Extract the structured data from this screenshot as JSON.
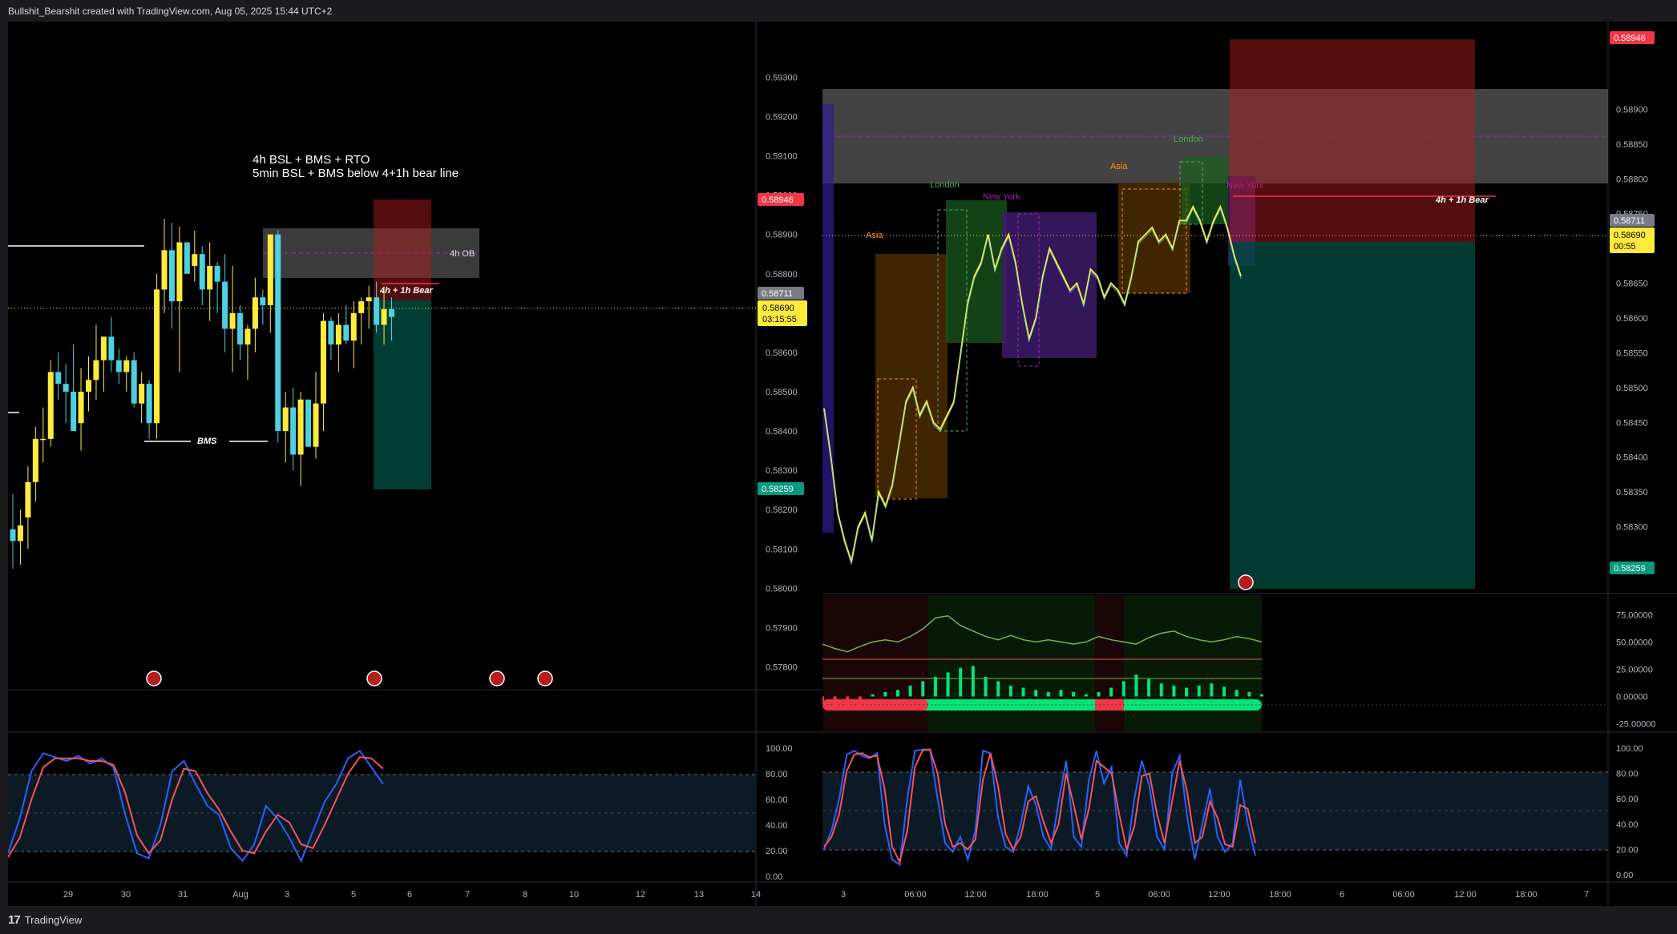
{
  "header": {
    "credit": "Bullshit_Bearshit created with TradingView.com, Aug 05, 2025 15:44 UTC+2"
  },
  "footer": {
    "brand_mark": "17",
    "brand": "TradingView"
  },
  "colors": {
    "background": "#000000",
    "bull": "#ffeb3b",
    "bear": "#4dd0e1",
    "price_tag": "#f23645",
    "target_tag": "#089981",
    "current_tag": "#ffeb3b"
  },
  "chart_data": [
    {
      "type": "candlestick",
      "panel": "left-main",
      "timeframe_hint": "1h",
      "x_ticks": [
        "29",
        "30",
        "31",
        "Aug",
        "3",
        "5",
        "6",
        "7",
        "8",
        "10",
        "12",
        "13",
        "14"
      ],
      "y_ticks": [
        "0.59300",
        "0.59200",
        "0.59100",
        "0.59000",
        "0.58900",
        "0.58800",
        "0.58600",
        "0.58500",
        "0.58400",
        "0.58300",
        "0.58200",
        "0.58100",
        "0.58000",
        "0.57900",
        "0.57800"
      ],
      "ylim": [
        0.5775,
        0.5936
      ],
      "annotations": {
        "note_line1": "4h BSL + BMS + RTO",
        "note_line2": "5min BSL + BMS below 4+1h bear line",
        "ob_label": "4h OB",
        "bear_label": "4h + 1h Bear",
        "bms_label": "BMS"
      },
      "tags": {
        "entry": "0.58946",
        "last_close": "0.58711",
        "current_price": "0.58690",
        "countdown": "03:15:55",
        "target": "0.58259"
      },
      "position": {
        "stop": 0.58946,
        "entry": 0.58711,
        "target": 0.58259
      },
      "ohlc": [
        [
          0.5815,
          0.5824,
          0.5805,
          0.5812
        ],
        [
          0.5812,
          0.582,
          0.5806,
          0.5816
        ],
        [
          0.5818,
          0.5831,
          0.581,
          0.5827
        ],
        [
          0.5827,
          0.5841,
          0.5822,
          0.5838
        ],
        [
          0.5838,
          0.5846,
          0.5832,
          0.5838
        ],
        [
          0.5838,
          0.5858,
          0.5836,
          0.5855
        ],
        [
          0.5855,
          0.586,
          0.5848,
          0.5852
        ],
        [
          0.5852,
          0.5857,
          0.5842,
          0.585
        ],
        [
          0.585,
          0.5862,
          0.584,
          0.584
        ],
        [
          0.5842,
          0.5856,
          0.5835,
          0.585
        ],
        [
          0.585,
          0.5859,
          0.5845,
          0.5853
        ],
        [
          0.5853,
          0.5867,
          0.5848,
          0.5858
        ],
        [
          0.5858,
          0.5864,
          0.585,
          0.5864
        ],
        [
          0.5864,
          0.5869,
          0.5855,
          0.5858
        ],
        [
          0.5858,
          0.5861,
          0.5852,
          0.5855
        ],
        [
          0.5855,
          0.5859,
          0.585,
          0.5858
        ],
        [
          0.5858,
          0.586,
          0.5846,
          0.5847
        ],
        [
          0.5847,
          0.5855,
          0.5842,
          0.5852
        ],
        [
          0.5852,
          0.5853,
          0.5838,
          0.5842
        ],
        [
          0.5842,
          0.588,
          0.5838,
          0.5876
        ],
        [
          0.5876,
          0.5894,
          0.587,
          0.5886
        ],
        [
          0.5886,
          0.5893,
          0.5866,
          0.5873
        ],
        [
          0.5873,
          0.5892,
          0.5855,
          0.5888
        ],
        [
          0.5888,
          0.5887,
          0.588,
          0.588
        ],
        [
          0.5882,
          0.5891,
          0.5878,
          0.5885
        ],
        [
          0.5885,
          0.5887,
          0.5872,
          0.5876
        ],
        [
          0.5876,
          0.5888,
          0.5868,
          0.5882
        ],
        [
          0.5882,
          0.5883,
          0.587,
          0.5878
        ],
        [
          0.5878,
          0.5885,
          0.586,
          0.5866
        ],
        [
          0.5866,
          0.5882,
          0.5855,
          0.587
        ],
        [
          0.587,
          0.5872,
          0.5858,
          0.5862
        ],
        [
          0.5862,
          0.5867,
          0.5853,
          0.5866
        ],
        [
          0.5866,
          0.5879,
          0.586,
          0.5874
        ],
        [
          0.5874,
          0.5876,
          0.5867,
          0.5872
        ],
        [
          0.5872,
          0.589,
          0.5865,
          0.589
        ],
        [
          0.589,
          0.5891,
          0.5837,
          0.584
        ],
        [
          0.584,
          0.585,
          0.5832,
          0.5846
        ],
        [
          0.5846,
          0.5851,
          0.583,
          0.5834
        ],
        [
          0.5834,
          0.585,
          0.5826,
          0.5848
        ],
        [
          0.5848,
          0.5845,
          0.5836,
          0.5836
        ],
        [
          0.5836,
          0.5855,
          0.5833,
          0.5847
        ],
        [
          0.5847,
          0.587,
          0.584,
          0.5868
        ],
        [
          0.5868,
          0.5869,
          0.5858,
          0.5862
        ],
        [
          0.5862,
          0.587,
          0.5855,
          0.5867
        ],
        [
          0.5867,
          0.5872,
          0.5862,
          0.5863
        ],
        [
          0.5863,
          0.5873,
          0.5856,
          0.587
        ],
        [
          0.587,
          0.5874,
          0.5862,
          0.5873
        ],
        [
          0.5873,
          0.5877,
          0.5866,
          0.5874
        ],
        [
          0.5874,
          0.5878,
          0.5865,
          0.5867
        ],
        [
          0.5867,
          0.5876,
          0.5862,
          0.5871
        ],
        [
          0.5871,
          0.5874,
          0.5863,
          0.5869
        ]
      ]
    },
    {
      "type": "line",
      "panel": "left-stochastic",
      "y_ticks": [
        "100.00",
        "80.00",
        "60.00",
        "40.00",
        "20.00",
        "0.00"
      ],
      "ylim": [
        0,
        100
      ],
      "levels": [
        80,
        50,
        20
      ],
      "k": [
        18,
        45,
        82,
        96,
        93,
        90,
        94,
        88,
        92,
        85,
        48,
        18,
        14,
        40,
        82,
        90,
        72,
        55,
        48,
        22,
        12,
        25,
        55,
        45,
        30,
        12,
        35,
        58,
        72,
        92,
        98,
        85,
        72
      ],
      "d": [
        15,
        30,
        60,
        85,
        92,
        92,
        92,
        90,
        90,
        87,
        65,
        32,
        18,
        28,
        60,
        84,
        82,
        65,
        52,
        35,
        20,
        18,
        35,
        48,
        42,
        25,
        22,
        40,
        60,
        80,
        93,
        92,
        84
      ]
    },
    {
      "type": "candlestick",
      "panel": "right-main",
      "timeframe_hint": "5m",
      "x_ticks": [
        "3",
        "06:00",
        "12:00",
        "18:00",
        "5",
        "06:00",
        "12:00",
        "18:00",
        "6",
        "06:00",
        "12:00",
        "18:00",
        "7"
      ],
      "y_ticks": [
        "0.58900",
        "0.58850",
        "0.58800",
        "0.58750",
        "0.58650",
        "0.58600",
        "0.58550",
        "0.58500",
        "0.58450",
        "0.58400",
        "0.58350",
        "0.58300"
      ],
      "ylim": [
        0.5822,
        0.5898
      ],
      "sessions": [
        {
          "name": "Asia",
          "low": 0.5834,
          "high": 0.5866,
          "color": "#ff9800"
        },
        {
          "name": "London",
          "low": 0.5862,
          "high": 0.5878,
          "color": "#4caf50"
        },
        {
          "name": "New York",
          "low": 0.5855,
          "high": 0.5872,
          "color": "#9c27b0"
        },
        {
          "name": "Asia",
          "low": 0.5862,
          "high": 0.5877,
          "color": "#ff9800"
        },
        {
          "name": "London",
          "low": 0.5867,
          "high": 0.588,
          "color": "#4caf50"
        },
        {
          "name": "New York",
          "low": 0.5864,
          "high": 0.5876,
          "color": "#9c27b0"
        }
      ],
      "annotations": {
        "bear_label": "4h + 1h Bear"
      },
      "tags": {
        "stop": "0.58946",
        "last_close": "0.58711",
        "current_price": "0.58690",
        "countdown": "00:55",
        "target": "0.58259"
      },
      "close": [
        0.5847,
        0.584,
        0.5832,
        0.5828,
        0.5825,
        0.583,
        0.5832,
        0.5828,
        0.5835,
        0.5833,
        0.5836,
        0.5842,
        0.5848,
        0.585,
        0.5846,
        0.5848,
        0.5845,
        0.5844,
        0.5846,
        0.5848,
        0.5855,
        0.5862,
        0.5866,
        0.5868,
        0.5872,
        0.5867,
        0.587,
        0.5872,
        0.5868,
        0.5862,
        0.5857,
        0.586,
        0.5866,
        0.587,
        0.5868,
        0.5866,
        0.5864,
        0.5865,
        0.5862,
        0.5867,
        0.5866,
        0.5863,
        0.5865,
        0.5864,
        0.5862,
        0.5866,
        0.5871,
        0.5872,
        0.5873,
        0.5871,
        0.5872,
        0.587,
        0.5874,
        0.5874,
        0.5876,
        0.5874,
        0.5871,
        0.5874,
        0.5876,
        0.5873,
        0.5869,
        0.5866
      ]
    },
    {
      "type": "area",
      "panel": "right-oscillator",
      "y_ticks": [
        "75.00000",
        "50.00000",
        "25.00000",
        "0.00000",
        "-25.00000"
      ],
      "ylim": [
        -32,
        90
      ],
      "line": [
        48,
        44,
        41,
        46,
        50,
        52,
        50,
        55,
        62,
        72,
        74,
        65,
        60,
        55,
        52,
        56,
        52,
        50,
        52,
        50,
        48,
        50,
        55,
        52,
        50,
        48,
        54,
        58,
        60,
        55,
        52,
        50,
        52,
        55,
        53,
        50
      ],
      "histogram": [
        -6,
        -10,
        -12,
        -8,
        2,
        4,
        6,
        10,
        14,
        18,
        22,
        26,
        28,
        18,
        14,
        10,
        8,
        6,
        4,
        6,
        4,
        2,
        4,
        8,
        14,
        20,
        16,
        12,
        10,
        8,
        10,
        12,
        9,
        6,
        4,
        2
      ]
    },
    {
      "type": "line",
      "panel": "right-stochastic",
      "y_ticks": [
        "100.00",
        "80.00",
        "60.00",
        "40.00",
        "20.00",
        "0.00"
      ],
      "ylim": [
        0,
        100
      ],
      "levels": [
        80,
        50,
        20
      ],
      "k": [
        20,
        35,
        60,
        95,
        98,
        94,
        92,
        96,
        40,
        12,
        8,
        60,
        98,
        99,
        99,
        60,
        25,
        18,
        30,
        12,
        35,
        98,
        96,
        45,
        22,
        18,
        40,
        70,
        55,
        30,
        20,
        58,
        90,
        30,
        22,
        75,
        98,
        72,
        85,
        25,
        15,
        60,
        90,
        70,
        30,
        20,
        80,
        94,
        45,
        12,
        40,
        68,
        30,
        18,
        25,
        75,
        40,
        15
      ],
      "d": [
        22,
        30,
        48,
        82,
        95,
        96,
        93,
        94,
        68,
        22,
        10,
        35,
        85,
        98,
        99,
        80,
        40,
        22,
        25,
        20,
        28,
        75,
        96,
        70,
        32,
        20,
        30,
        58,
        62,
        42,
        25,
        40,
        80,
        55,
        28,
        52,
        90,
        85,
        80,
        48,
        20,
        38,
        78,
        80,
        48,
        25,
        58,
        90,
        65,
        25,
        30,
        58,
        45,
        24,
        22,
        55,
        52,
        25
      ]
    }
  ]
}
